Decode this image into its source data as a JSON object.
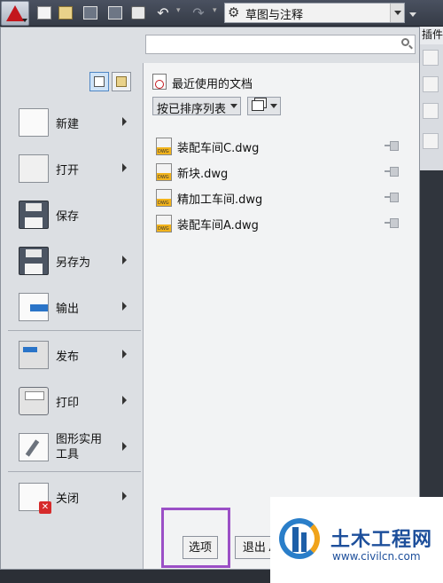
{
  "toolbar": {
    "workspace_label": "草图与注释",
    "icons": [
      "new-icon",
      "open-icon",
      "save-icon",
      "save-as-icon",
      "plot-icon",
      "undo-icon",
      "redo-icon"
    ]
  },
  "ribbon_edge": {
    "tab_fragment": "插件"
  },
  "search": {
    "value": "",
    "placeholder": ""
  },
  "commands": [
    {
      "label": "新建",
      "submenu": true,
      "icon": "new-doc-icon"
    },
    {
      "label": "打开",
      "submenu": true,
      "icon": "open-folder-icon"
    },
    {
      "label": "保存",
      "submenu": false,
      "icon": "save-floppy-icon"
    },
    {
      "label": "另存为",
      "submenu": true,
      "icon": "save-as-floppy-icon"
    },
    {
      "label": "输出",
      "submenu": true,
      "icon": "export-icon"
    },
    {
      "label": "发布",
      "submenu": true,
      "icon": "publish-icon"
    },
    {
      "label": "打印",
      "submenu": true,
      "icon": "printer-icon"
    },
    {
      "label": "图形实用\n工具",
      "submenu": true,
      "icon": "drawing-utilities-icon"
    },
    {
      "label": "关闭",
      "submenu": true,
      "icon": "close-doc-icon"
    }
  ],
  "recent": {
    "title": "最近使用的文档",
    "sort_label": "按已排序列表",
    "documents": [
      {
        "name": "装配车间C.dwg"
      },
      {
        "name": "新块.dwg"
      },
      {
        "name": "精加工车间.dwg"
      },
      {
        "name": "装配车间A.dwg"
      }
    ]
  },
  "buttons": {
    "options": "选项",
    "exit": "退出 A"
  },
  "watermark": {
    "title": "土木工程网",
    "url": "www.civilcn.com"
  },
  "colors": {
    "accent_highlight": "#9b4fc6",
    "autocad_red": "#c3161c",
    "watermark_blue": "#1d4f9b"
  }
}
